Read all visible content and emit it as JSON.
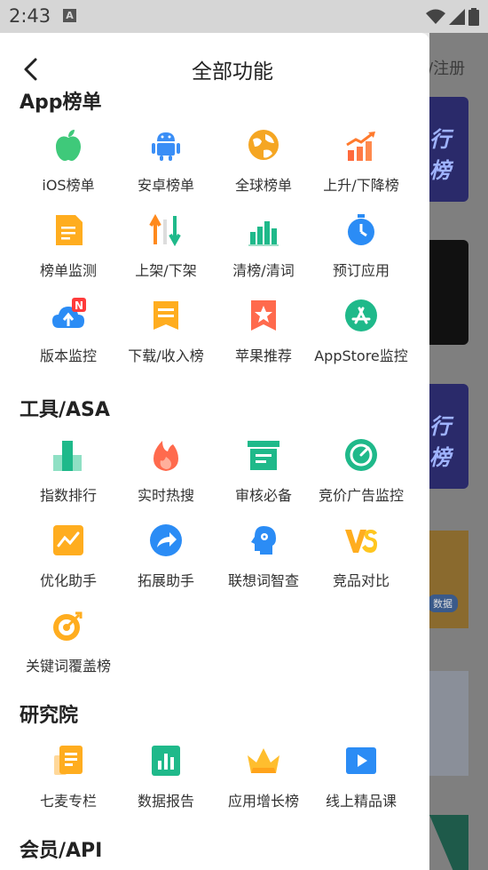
{
  "status_bar": {
    "time": "2:43",
    "notif": "A"
  },
  "background": {
    "register_text": "/注册",
    "banner_text": "行榜",
    "badge_text": "数据"
  },
  "header": {
    "title": "全部功能"
  },
  "sections": [
    {
      "title": "App榜单",
      "items": [
        {
          "label": "iOS榜单",
          "icon": "apple-icon"
        },
        {
          "label": "安卓榜单",
          "icon": "android-icon"
        },
        {
          "label": "全球榜单",
          "icon": "globe-icon"
        },
        {
          "label": "上升/下降榜",
          "icon": "trend-chart-icon"
        },
        {
          "label": "榜单监测",
          "icon": "document-icon"
        },
        {
          "label": "上架/下架",
          "icon": "up-down-arrows-icon"
        },
        {
          "label": "清榜/清词",
          "icon": "bar-chart-icon"
        },
        {
          "label": "预订应用",
          "icon": "timer-icon"
        },
        {
          "label": "版本监控",
          "icon": "cloud-upload-icon"
        },
        {
          "label": "下载/收入榜",
          "icon": "receipt-icon"
        },
        {
          "label": "苹果推荐",
          "icon": "star-bookmark-icon"
        },
        {
          "label": "AppStore监控",
          "icon": "appstore-icon"
        }
      ]
    },
    {
      "title": "工具/ASA",
      "items": [
        {
          "label": "指数排行",
          "icon": "index-bars-icon"
        },
        {
          "label": "实时热搜",
          "icon": "flame-icon"
        },
        {
          "label": "审核必备",
          "icon": "review-box-icon"
        },
        {
          "label": "竞价广告监控",
          "icon": "gauge-icon"
        },
        {
          "label": "优化助手",
          "icon": "line-chart-icon"
        },
        {
          "label": "拓展助手",
          "icon": "share-arrow-icon"
        },
        {
          "label": "联想词智查",
          "icon": "brain-head-icon"
        },
        {
          "label": "竞品对比",
          "icon": "versus-icon"
        },
        {
          "label": "关键词覆盖榜",
          "icon": "target-icon"
        }
      ]
    },
    {
      "title": "研究院",
      "items": [
        {
          "label": "七麦专栏",
          "icon": "column-doc-icon"
        },
        {
          "label": "数据报告",
          "icon": "report-icon"
        },
        {
          "label": "应用增长榜",
          "icon": "crown-icon"
        },
        {
          "label": "线上精品课",
          "icon": "play-icon"
        }
      ]
    },
    {
      "title": "会员/API",
      "items": []
    }
  ]
}
